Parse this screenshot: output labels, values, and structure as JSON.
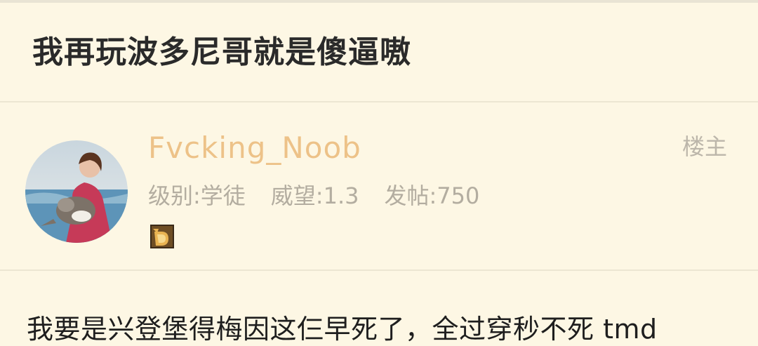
{
  "thread": {
    "title": "我再玩波多尼哥就是傻逼嗷"
  },
  "post": {
    "author": {
      "username": "Fvcking_Noob",
      "level": "级别:学徒",
      "prestige": "威望:1.3",
      "posts": "发帖:750",
      "avatar": "avatar-photo",
      "badge": "badge-icon"
    },
    "role_tag": "楼主",
    "content": "我要是兴登堡得梅因这仨早死了，全过穿秒不死 tmd"
  },
  "colors": {
    "background": "#fdf7e4",
    "username": "#edc288",
    "meta": "#b3ada0",
    "title": "#2a2a2a"
  }
}
